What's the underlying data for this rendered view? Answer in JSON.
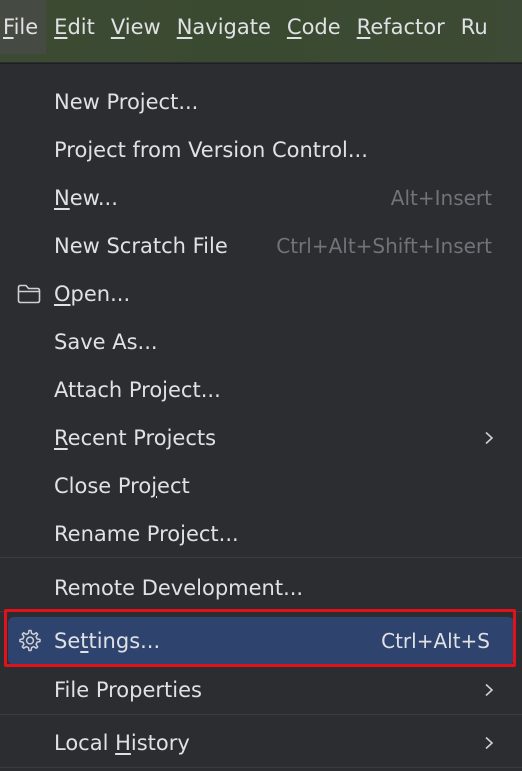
{
  "menubar": {
    "items": [
      {
        "pre": "",
        "mn": "F",
        "post": "ile"
      },
      {
        "pre": "",
        "mn": "E",
        "post": "dit"
      },
      {
        "pre": "",
        "mn": "V",
        "post": "iew"
      },
      {
        "pre": "",
        "mn": "N",
        "post": "avigate"
      },
      {
        "pre": "",
        "mn": "C",
        "post": "ode"
      },
      {
        "pre": "",
        "mn": "R",
        "post": "efactor"
      },
      {
        "pre": "",
        "mn": "",
        "post": "Ru"
      }
    ]
  },
  "menu": {
    "items": [
      {
        "pre": "New Project...",
        "mn": "",
        "post": "",
        "shortcut": ""
      },
      {
        "pre": "Project from Version Control...",
        "mn": "",
        "post": "",
        "shortcut": ""
      },
      {
        "pre": "",
        "mn": "N",
        "post": "ew...",
        "shortcut": "Alt+Insert"
      },
      {
        "pre": "New Scratch File",
        "mn": "",
        "post": "",
        "shortcut": "Ctrl+Alt+Shift+Insert"
      },
      {
        "pre": "",
        "mn": "O",
        "post": "pen...",
        "shortcut": "",
        "icon": "folder-icon"
      },
      {
        "pre": "Save As...",
        "mn": "",
        "post": "",
        "shortcut": ""
      },
      {
        "pre": "Attach Project...",
        "mn": "",
        "post": "",
        "shortcut": ""
      },
      {
        "pre": "",
        "mn": "R",
        "post": "ecent Projects",
        "shortcut": "",
        "submenu": true
      },
      {
        "pre": "Close Pro",
        "mn": "j",
        "post": "ect",
        "shortcut": ""
      },
      {
        "pre": "Rename Project...",
        "mn": "",
        "post": "",
        "shortcut": ""
      },
      {
        "pre": "Remote Development...",
        "mn": "",
        "post": "",
        "shortcut": ""
      },
      {
        "pre": "Se",
        "mn": "t",
        "post": "tings...",
        "shortcut": "Ctrl+Alt+S",
        "icon": "gear-icon",
        "selected": true
      },
      {
        "pre": "File Properties",
        "mn": "",
        "post": "",
        "shortcut": "",
        "submenu": true
      },
      {
        "pre": "Local ",
        "mn": "H",
        "post": "istory",
        "shortcut": "",
        "submenu": true
      }
    ]
  },
  "colors": {
    "background": "#2b2d30",
    "selection": "#2e436e",
    "highlight_border": "#e0121c",
    "shortcut_text": "#6f737a"
  }
}
